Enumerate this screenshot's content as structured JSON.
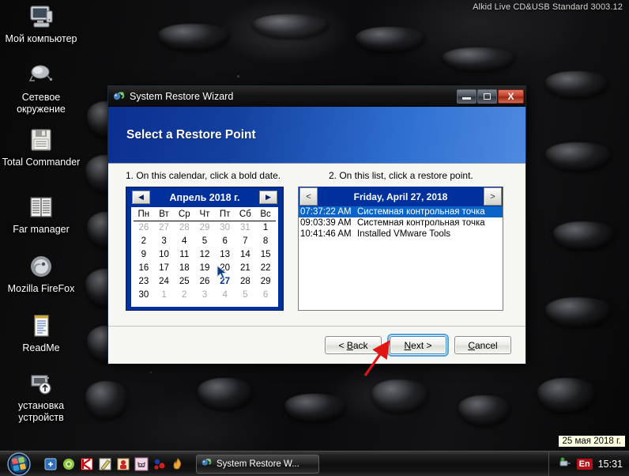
{
  "desktop": {
    "watermark": "Alkid Live CD&USB Standard 3003.12",
    "icons": [
      {
        "icon": "my-computer-icon",
        "label": "Мой компьютер"
      },
      {
        "icon": "network-neighborhood-icon",
        "label": "Сетевое окружение"
      },
      {
        "icon": "floppy-disk-icon",
        "label": "Total Commander"
      },
      {
        "icon": "file-manager-icon",
        "label": "Far manager"
      },
      {
        "icon": "firefox-icon",
        "label": "Mozilla FireFox"
      },
      {
        "icon": "notepad-icon",
        "label": "ReadMe"
      },
      {
        "icon": "device-install-icon",
        "label": "установка устройств"
      }
    ]
  },
  "dialog": {
    "title": "System Restore Wizard",
    "titlebar_icon": "system-restore-icon",
    "window_buttons": {
      "minimize": "minimize-icon",
      "maximize": "maximize-icon",
      "close": "X"
    },
    "banner_title": "Select a Restore Point",
    "instruction_1": "1. On this calendar, click a bold date.",
    "instruction_2": "2. On this list, click a restore point.",
    "calendar": {
      "prev_label": "◀",
      "next_label": "▶",
      "month_label": "Апрель 2018 г.",
      "weekdays": [
        "Пн",
        "Вт",
        "Ср",
        "Чт",
        "Пт",
        "Сб",
        "Вс"
      ],
      "weeks": [
        [
          {
            "d": "26",
            "s": "dim"
          },
          {
            "d": "27",
            "s": "dim"
          },
          {
            "d": "28",
            "s": "dim"
          },
          {
            "d": "29",
            "s": "dim"
          },
          {
            "d": "30",
            "s": "dim"
          },
          {
            "d": "31",
            "s": "dim"
          },
          {
            "d": "1",
            "s": ""
          }
        ],
        [
          {
            "d": "2",
            "s": ""
          },
          {
            "d": "3",
            "s": ""
          },
          {
            "d": "4",
            "s": ""
          },
          {
            "d": "5",
            "s": ""
          },
          {
            "d": "6",
            "s": ""
          },
          {
            "d": "7",
            "s": ""
          },
          {
            "d": "8",
            "s": ""
          }
        ],
        [
          {
            "d": "9",
            "s": ""
          },
          {
            "d": "10",
            "s": ""
          },
          {
            "d": "11",
            "s": ""
          },
          {
            "d": "12",
            "s": ""
          },
          {
            "d": "13",
            "s": ""
          },
          {
            "d": "14",
            "s": ""
          },
          {
            "d": "15",
            "s": ""
          }
        ],
        [
          {
            "d": "16",
            "s": ""
          },
          {
            "d": "17",
            "s": ""
          },
          {
            "d": "18",
            "s": ""
          },
          {
            "d": "19",
            "s": ""
          },
          {
            "d": "20",
            "s": ""
          },
          {
            "d": "21",
            "s": ""
          },
          {
            "d": "22",
            "s": ""
          }
        ],
        [
          {
            "d": "23",
            "s": ""
          },
          {
            "d": "24",
            "s": ""
          },
          {
            "d": "25",
            "s": ""
          },
          {
            "d": "26",
            "s": ""
          },
          {
            "d": "27",
            "s": "sel"
          },
          {
            "d": "28",
            "s": ""
          },
          {
            "d": "29",
            "s": ""
          }
        ],
        [
          {
            "d": "30",
            "s": ""
          },
          {
            "d": "1",
            "s": "dim"
          },
          {
            "d": "2",
            "s": "dim"
          },
          {
            "d": "3",
            "s": "dim"
          },
          {
            "d": "4",
            "s": "dim"
          },
          {
            "d": "5",
            "s": "dim"
          },
          {
            "d": "6",
            "s": "dim"
          }
        ]
      ]
    },
    "restore_list": {
      "prev_label": "<",
      "next_label": ">",
      "date_header": "Friday, April 27, 2018",
      "items": [
        {
          "time": "07:37:22 AM",
          "description": "Системная контрольная точка",
          "selected": true
        },
        {
          "time": "09:03:39 AM",
          "description": "Системная контрольная точка",
          "selected": false
        },
        {
          "time": "10:41:46 AM",
          "description": "Installed VMware Tools",
          "selected": false
        }
      ]
    },
    "buttons": {
      "back": "< Back",
      "next": "Next >",
      "cancel": "Cancel"
    },
    "colors": {
      "banner_start": "#0b2f91",
      "banner_end": "#4f8ae0",
      "calendar_bg": "#00309c",
      "selection": "#0a64c8",
      "annotation_arrow": "#e11414",
      "close_button": "#c03f28"
    }
  },
  "taskbar": {
    "start_icon": "windows-orb-icon",
    "quick_launch": [
      "show-desktop-icon",
      "browser-icon",
      "kaspersky-icon",
      "pencil-icon",
      "security-icon",
      "cat-icon",
      "molecule-icon",
      "flame-icon"
    ],
    "tasks": [
      {
        "icon": "system-restore-icon",
        "label": "System Restore W..."
      }
    ],
    "tray": {
      "safely-remove-icon": "safely-remove-icon",
      "language": "En",
      "clock": "15:31"
    },
    "date_tooltip": "25 мая 2018 г."
  }
}
